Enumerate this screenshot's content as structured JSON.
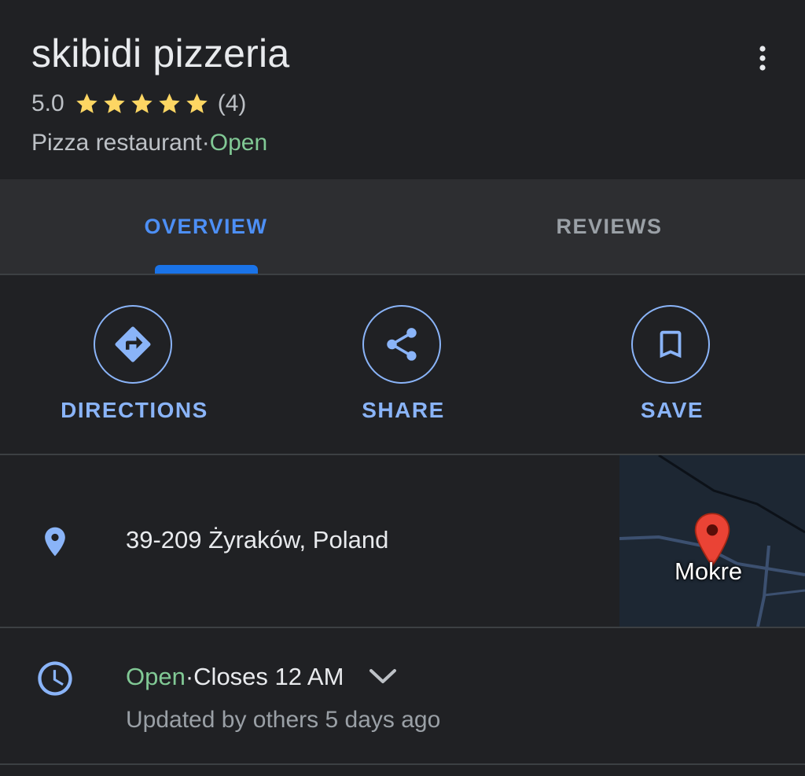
{
  "place": {
    "name": "skibidi pizzeria",
    "rating": "5.0",
    "stars": 5,
    "review_count": "(4)",
    "category": "Pizza restaurant",
    "separator": " · ",
    "status": "Open"
  },
  "tabs": [
    {
      "label": "OVERVIEW",
      "active": true
    },
    {
      "label": "REVIEWS",
      "active": false
    }
  ],
  "actions": [
    {
      "label": "DIRECTIONS",
      "icon": "directions-icon"
    },
    {
      "label": "SHARE",
      "icon": "share-icon"
    },
    {
      "label": "SAVE",
      "icon": "bookmark-icon"
    }
  ],
  "address": {
    "text": "39-209 Żyraków, Poland",
    "icon": "location-pin-icon",
    "map_label": "Mokre"
  },
  "hours": {
    "status": "Open",
    "separator": " · ",
    "closes": "Closes 12 AM",
    "updated": "Updated by others 5 days ago",
    "icon": "clock-icon"
  },
  "colors": {
    "background": "#202124",
    "tab_bar": "#2d2e31",
    "accent_blue": "#8ab4f8",
    "active_tab": "#1a73e8",
    "open_green": "#81c995",
    "star_yellow": "#fdd663",
    "pin_red": "#ea4335"
  }
}
